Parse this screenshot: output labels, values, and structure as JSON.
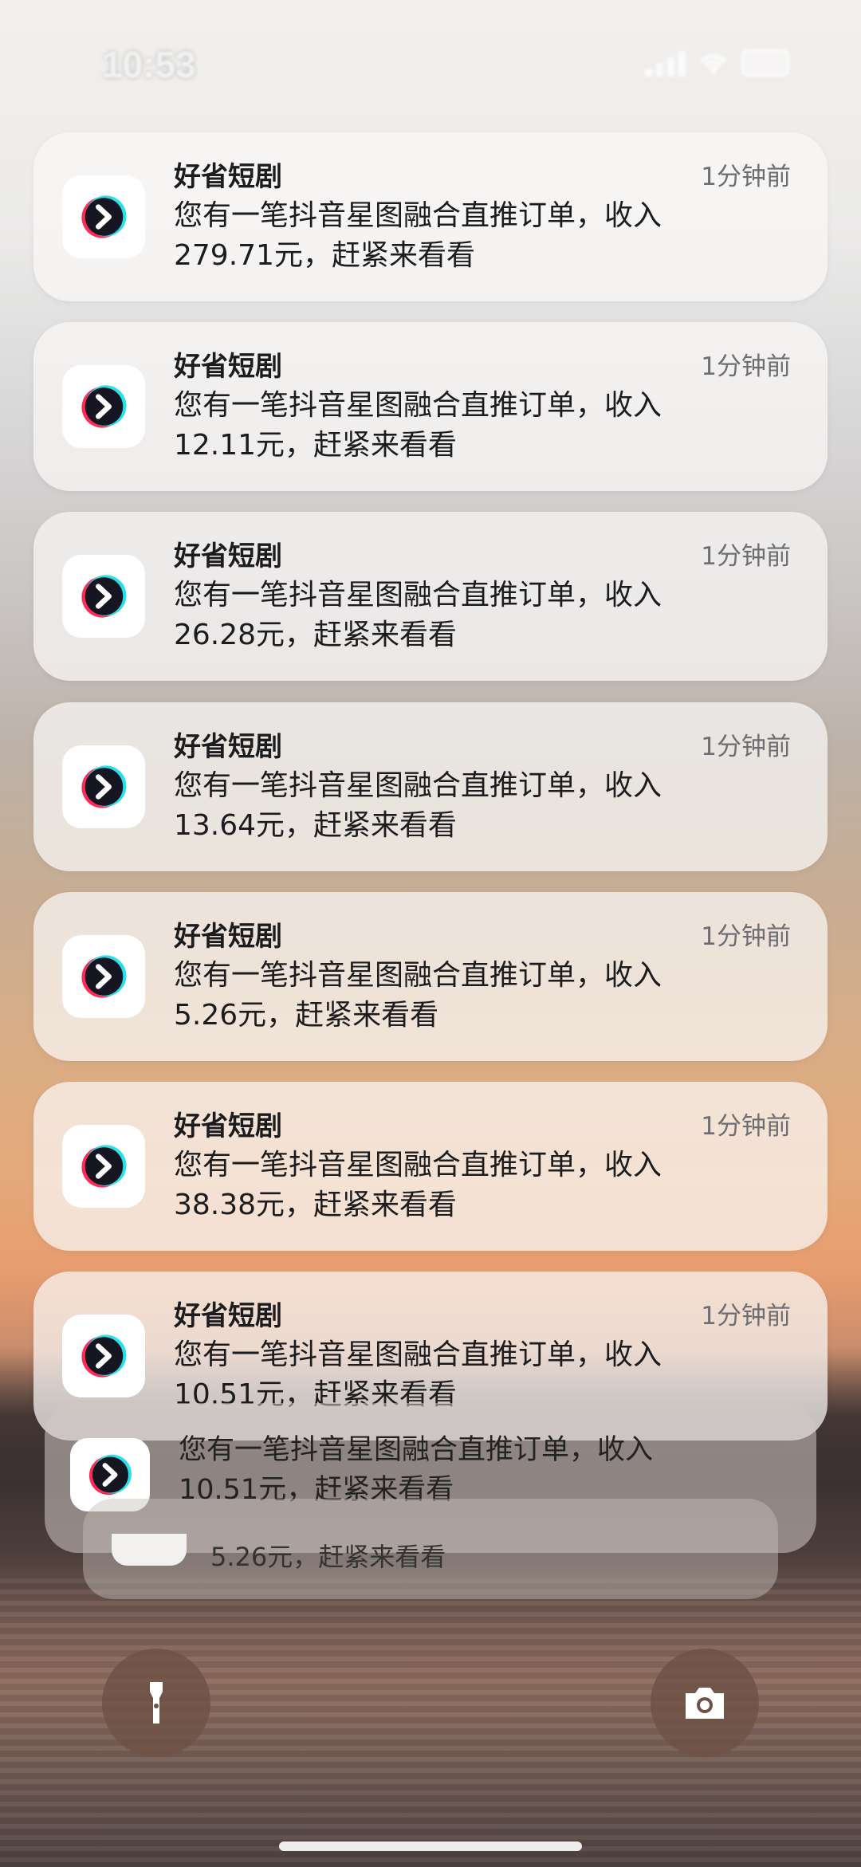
{
  "status_bar": {
    "time": "10:53"
  },
  "notifications": [
    {
      "app": "好省短剧",
      "time": "1分钟前",
      "line1": "您有一笔抖音星图融合直推订单，收入",
      "line2": "279.71元，赶紧来看看"
    },
    {
      "app": "好省短剧",
      "time": "1分钟前",
      "line1": "您有一笔抖音星图融合直推订单，收入",
      "line2": "12.11元，赶紧来看看"
    },
    {
      "app": "好省短剧",
      "time": "1分钟前",
      "line1": "您有一笔抖音星图融合直推订单，收入",
      "line2": "26.28元，赶紧来看看"
    },
    {
      "app": "好省短剧",
      "time": "1分钟前",
      "line1": "您有一笔抖音星图融合直推订单，收入",
      "line2": "13.64元，赶紧来看看"
    },
    {
      "app": "好省短剧",
      "time": "1分钟前",
      "line1": "您有一笔抖音星图融合直推订单，收入",
      "line2": "5.26元，赶紧来看看"
    },
    {
      "app": "好省短剧",
      "time": "1分钟前",
      "line1": "您有一笔抖音星图融合直推订单，收入",
      "line2": "38.38元，赶紧来看看"
    },
    {
      "app": "好省短剧",
      "time": "1分钟前",
      "line1": "您有一笔抖音星图融合直推订单，收入",
      "line2": "10.51元，赶紧来看看"
    }
  ],
  "stacked": [
    {
      "line1": "您有一笔抖音星图融合直推订单，收入",
      "line2": "10.51元，赶紧来看看"
    },
    {
      "line2": "5.26元，赶紧来看看"
    }
  ],
  "icons": {
    "app_icon": "play-chevron-icon",
    "flashlight": "flashlight-icon",
    "camera": "camera-icon"
  }
}
